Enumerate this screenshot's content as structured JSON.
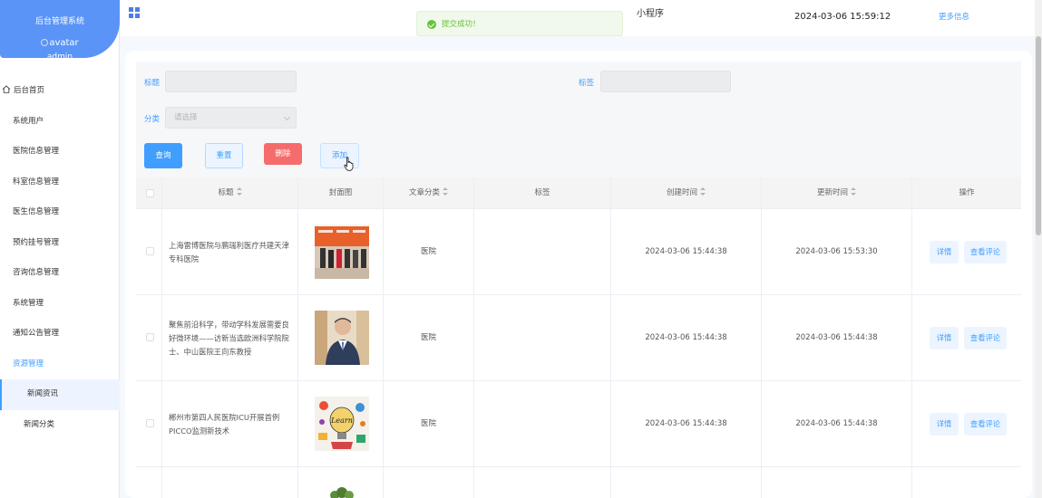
{
  "sidebar": {
    "system_title": "后台管理系统",
    "avatar_alt": "avatar",
    "username": "admin",
    "items": [
      {
        "label": "后台首页"
      },
      {
        "label": "系统用户"
      },
      {
        "label": "医院信息管理"
      },
      {
        "label": "科室信息管理"
      },
      {
        "label": "医生信息管理"
      },
      {
        "label": "预约挂号管理"
      },
      {
        "label": "咨询信息管理"
      },
      {
        "label": "系统管理"
      },
      {
        "label": "通知公告管理"
      },
      {
        "label": "资源管理"
      },
      {
        "label": "新闻资讯"
      },
      {
        "label": "新闻分类"
      }
    ]
  },
  "header": {
    "title_partial": "小程序",
    "datetime": "2024-03-06 15:59:12",
    "more_info": "更多信息"
  },
  "toast": {
    "message": "提交成功！",
    "type": "success"
  },
  "filters": {
    "title_label": "标题",
    "title_value": "",
    "tag_label": "标签",
    "tag_value": "",
    "category_label": "分类",
    "category_placeholder": "请选择"
  },
  "toolbar": {
    "query": "查询",
    "reset": "重置",
    "delete": "删除",
    "add": "添加"
  },
  "table": {
    "columns": [
      "标题",
      "封面图",
      "文章分类",
      "标签",
      "创建时间",
      "更新时间",
      "操作"
    ],
    "rows": [
      {
        "title": "上海雷博医院与鹏瑞利医疗共建天津专科医院",
        "category": "医院",
        "tag": "",
        "created": "2024-03-06 15:44:38",
        "updated": "2024-03-06 15:53:30",
        "cover": "meeting-photo"
      },
      {
        "title": "聚焦前沿科学，带动学科发展需要良好微环境——访新当选欧洲科学院院士、中山医院王向东教授",
        "category": "医院",
        "tag": "",
        "created": "2024-03-06 15:44:38",
        "updated": "2024-03-06 15:44:38",
        "cover": "portrait-photo"
      },
      {
        "title": "郴州市第四人民医院ICU开展首例PICCO监测新技术",
        "category": "医院",
        "tag": "",
        "created": "2024-03-06 15:44:38",
        "updated": "2024-03-06 15:44:38",
        "cover": "learn-illustration"
      }
    ],
    "detail_label": "详情",
    "comments_label": "查看评论"
  },
  "colors": {
    "primary": "#409eff",
    "sidebar_header": "#5a94f7",
    "danger": "#f56c6c",
    "success": "#67c23a"
  }
}
